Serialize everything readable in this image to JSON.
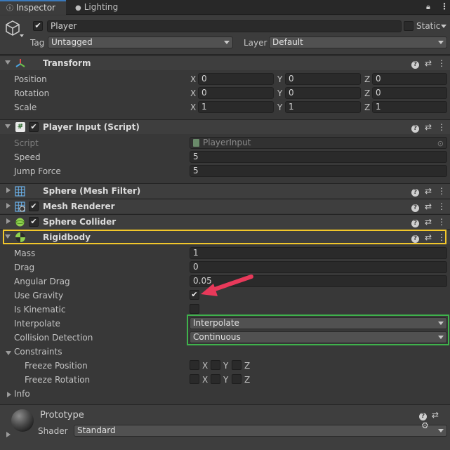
{
  "tabs": {
    "inspector": "Inspector",
    "lighting": "Lighting"
  },
  "object": {
    "name": "Player",
    "static_label": "Static",
    "tag_label": "Tag",
    "tag_value": "Untagged",
    "layer_label": "Layer",
    "layer_value": "Default"
  },
  "transform": {
    "title": "Transform",
    "rows": [
      {
        "label": "Position",
        "x": "0",
        "y": "0",
        "z": "0"
      },
      {
        "label": "Rotation",
        "x": "0",
        "y": "0",
        "z": "0"
      },
      {
        "label": "Scale",
        "x": "1",
        "y": "1",
        "z": "1"
      }
    ]
  },
  "axes": {
    "x": "X",
    "y": "Y",
    "z": "Z"
  },
  "player_input": {
    "title": "Player Input (Script)",
    "script_label": "Script",
    "script_value": "PlayerInput",
    "speed_label": "Speed",
    "speed_value": "5",
    "jump_label": "Jump Force",
    "jump_value": "5"
  },
  "mesh_filter": {
    "title": "Sphere (Mesh Filter)"
  },
  "mesh_renderer": {
    "title": "Mesh Renderer"
  },
  "sphere_collider": {
    "title": "Sphere Collider"
  },
  "rigidbody": {
    "title": "Rigidbody",
    "mass_label": "Mass",
    "mass_value": "1",
    "drag_label": "Drag",
    "drag_value": "0",
    "angular_label": "Angular Drag",
    "angular_value": "0.05",
    "gravity_label": "Use Gravity",
    "kinematic_label": "Is Kinematic",
    "interpolate_label": "Interpolate",
    "interpolate_value": "Interpolate",
    "collision_label": "Collision Detection",
    "collision_value": "Continuous",
    "constraints_label": "Constraints",
    "freeze_pos_label": "Freeze Position",
    "freeze_rot_label": "Freeze Rotation",
    "info_label": "Info"
  },
  "material": {
    "name": "Prototype",
    "shader_label": "Shader",
    "shader_value": "Standard"
  },
  "colors": {
    "highlight_yellow": "#f2c72b",
    "highlight_green": "#3fb24c",
    "arrow": "#e8395a",
    "accent_blue": "#3a79bb"
  }
}
